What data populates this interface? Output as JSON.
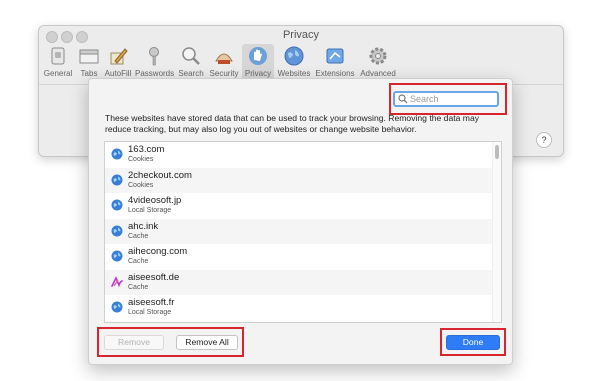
{
  "window": {
    "title": "Privacy"
  },
  "toolbar": {
    "items": [
      {
        "label": "General",
        "icon": "general-icon"
      },
      {
        "label": "Tabs",
        "icon": "tabs-icon"
      },
      {
        "label": "AutoFill",
        "icon": "autofill-icon"
      },
      {
        "label": "Passwords",
        "icon": "passwords-icon"
      },
      {
        "label": "Search",
        "icon": "search-icon"
      },
      {
        "label": "Security",
        "icon": "security-icon"
      },
      {
        "label": "Privacy",
        "icon": "privacy-icon",
        "active": true
      },
      {
        "label": "Websites",
        "icon": "websites-icon"
      },
      {
        "label": "Extensions",
        "icon": "extensions-icon"
      },
      {
        "label": "Advanced",
        "icon": "advanced-icon"
      }
    ]
  },
  "help": {
    "label": "?"
  },
  "sheet": {
    "search": {
      "placeholder": "Search",
      "value": ""
    },
    "description": "These websites have stored data that can be used to track your browsing. Removing the data may reduce tracking, but may also log you out of websites or change website behavior.",
    "websites": [
      {
        "site": "163.com",
        "kind": "Cookies",
        "icon": "globe-icon"
      },
      {
        "site": "2checkout.com",
        "kind": "Cookies",
        "icon": "globe-icon"
      },
      {
        "site": "4videosoft.jp",
        "kind": "Local Storage",
        "icon": "globe-icon"
      },
      {
        "site": "ahc.ink",
        "kind": "Cache",
        "icon": "globe-icon"
      },
      {
        "site": "aihecong.com",
        "kind": "Cache",
        "icon": "globe-icon"
      },
      {
        "site": "aiseesoft.de",
        "kind": "Cache",
        "icon": "aiseesoft-logo-icon"
      },
      {
        "site": "aiseesoft.fr",
        "kind": "Local Storage",
        "icon": "globe-icon"
      }
    ],
    "buttons": {
      "remove": "Remove",
      "remove_all": "Remove All",
      "done": "Done"
    }
  },
  "colors": {
    "highlight": "#d8262f",
    "accent": "#2f7df6"
  }
}
